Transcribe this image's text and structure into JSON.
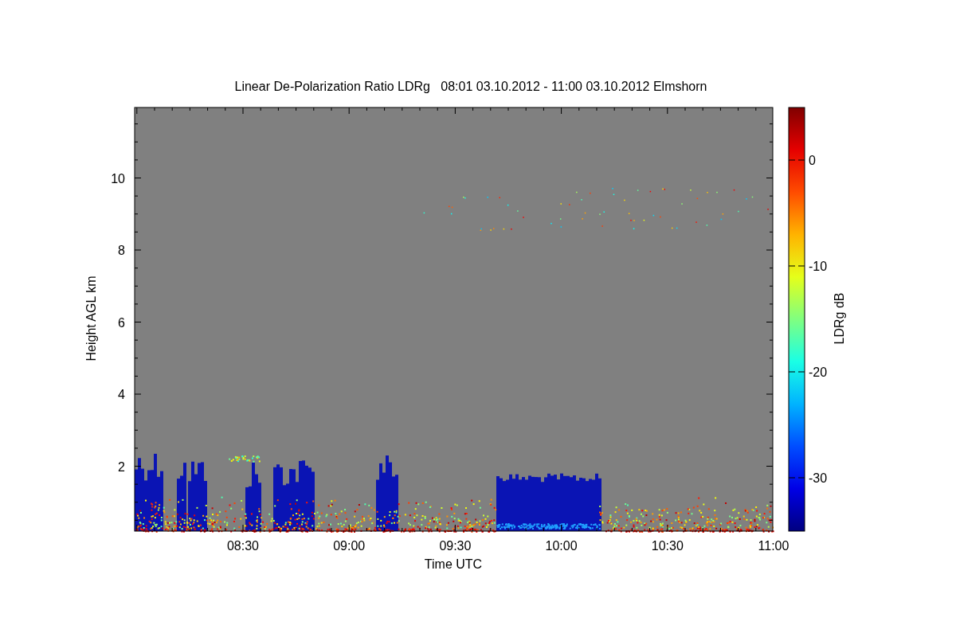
{
  "figure": {
    "title": "Linear De-Polarization Ratio LDRg   08:01 03.10.2012 - 11:00 03.10.2012 Elmshorn",
    "plot": {
      "ylabel": "Height AGL km",
      "xlabel": "Time UTC",
      "yticks": [
        "10",
        "8",
        "6",
        "4",
        "2"
      ],
      "xticks": [
        "08:30",
        "09:00",
        "09:30",
        "10:00",
        "10:30",
        "11:00"
      ]
    },
    "colorbar": {
      "label": "LDRg dB",
      "ticks": [
        "0",
        "-10",
        "-20",
        "-30"
      ]
    }
  }
}
